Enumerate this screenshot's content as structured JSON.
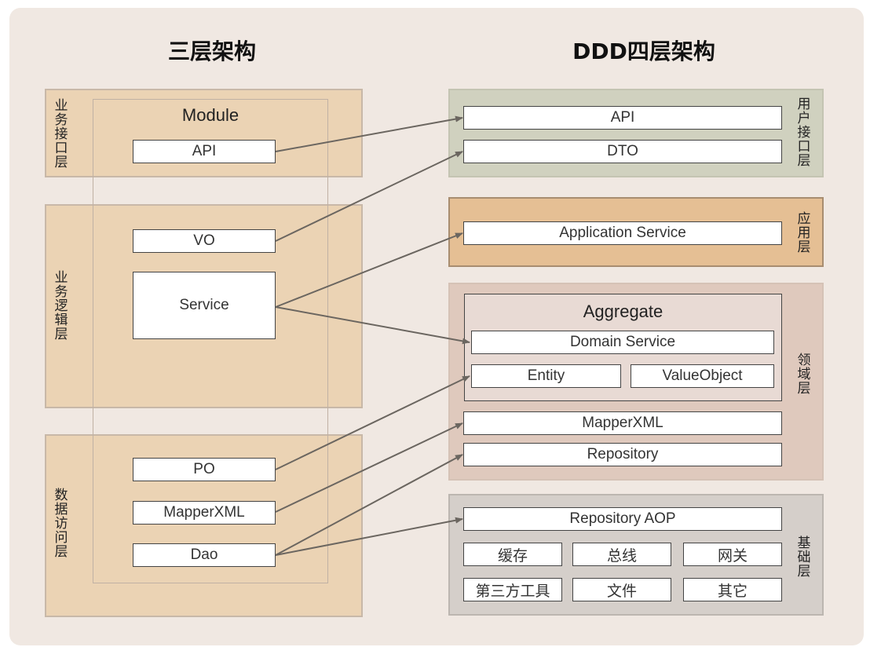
{
  "left": {
    "title": "三层架构",
    "module_label": "Module",
    "layers": [
      {
        "label": "业务接口层",
        "items": [
          "API"
        ]
      },
      {
        "label": "业务逻辑层",
        "items": [
          "VO",
          "Service"
        ]
      },
      {
        "label": "数据访问层",
        "items": [
          "PO",
          "MapperXML",
          "Dao"
        ]
      }
    ]
  },
  "right": {
    "title": "DDD四层架构",
    "layers": [
      {
        "label": "用户接口层",
        "items": [
          "API",
          "DTO"
        ],
        "color": "#d0d1bf"
      },
      {
        "label": "应用层",
        "items": [
          "Application Service"
        ],
        "color": "#e5bf94"
      },
      {
        "label": "领域层",
        "aggregate": {
          "title": "Aggregate",
          "items": [
            "Domain Service",
            "Entity",
            "ValueObject"
          ]
        },
        "items": [
          "MapperXML",
          "Repository"
        ],
        "color": "#dfc9bd"
      },
      {
        "label": "基础层",
        "items": [
          "Repository AOP",
          "缓存",
          "总线",
          "网关",
          "第三方工具",
          "文件",
          "其它"
        ],
        "color": "#d5cfca"
      }
    ]
  },
  "mappings": [
    {
      "from": "API",
      "to": "API"
    },
    {
      "from": "VO",
      "to": "DTO"
    },
    {
      "from": "Service",
      "to": "Application Service"
    },
    {
      "from": "Service",
      "to": "Domain Service"
    },
    {
      "from": "PO",
      "to": "Entity"
    },
    {
      "from": "MapperXML",
      "to": "MapperXML"
    },
    {
      "from": "Dao",
      "to": "Repository"
    },
    {
      "from": "Dao",
      "to": "Repository AOP"
    }
  ],
  "colors": {
    "tan": "#ebd3b4",
    "arrow": "#6b6660",
    "background": "#f0e8e2"
  }
}
